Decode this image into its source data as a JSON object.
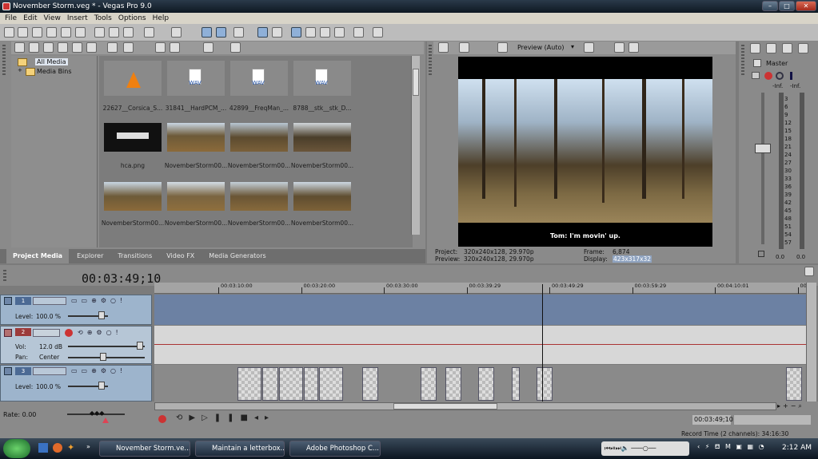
{
  "window": {
    "title": "November Storm.veg * - Vegas Pro 9.0"
  },
  "menu": [
    "File",
    "Edit",
    "View",
    "Insert",
    "Tools",
    "Options",
    "Help"
  ],
  "media_tree": {
    "items": [
      "All Media",
      "Media Bins"
    ]
  },
  "media_grid": {
    "items": [
      {
        "label": "22627__Corsica_S...",
        "kind": "vlc"
      },
      {
        "label": "31841__HardPCM_...",
        "kind": "wav"
      },
      {
        "label": "42899__FreqMan_...",
        "kind": "wav"
      },
      {
        "label": "8788__stk__stk_D...",
        "kind": "wav"
      },
      {
        "label": "hca.png",
        "kind": "logo"
      },
      {
        "label": "NovemberStorm00...",
        "kind": "forest"
      },
      {
        "label": "NovemberStorm00...",
        "kind": "forest"
      },
      {
        "label": "NovemberStorm00...",
        "kind": "forest"
      },
      {
        "label": "NovemberStorm00...",
        "kind": "forest"
      },
      {
        "label": "NovemberStorm00...",
        "kind": "forest"
      },
      {
        "label": "NovemberStorm00...",
        "kind": "forest"
      },
      {
        "label": "NovemberStorm00...",
        "kind": "forest"
      }
    ],
    "wav_badge": "WAV"
  },
  "media_tabs": [
    "Project Media",
    "Explorer",
    "Transitions",
    "Video FX",
    "Media Generators"
  ],
  "preview": {
    "mode": "Preview (Auto)",
    "subtitle": "Tom: I'm movin' up.",
    "project_label": "Project:",
    "project_value": "320x240x128, 29.970p",
    "preview_label": "Preview:",
    "preview_value": "320x240x128, 29.970p",
    "frame_label": "Frame:",
    "frame_value": "6,874",
    "display_label": "Display:",
    "display_value": "423x317x32"
  },
  "master": {
    "title": "Master",
    "inf_left": "-Inf.",
    "inf_right": "-Inf.",
    "scale": [
      "3",
      "6",
      "9",
      "12",
      "15",
      "18",
      "21",
      "24",
      "27",
      "30",
      "33",
      "36",
      "39",
      "42",
      "45",
      "48",
      "51",
      "54",
      "57"
    ],
    "val_left": "0.0",
    "val_right": "0.0"
  },
  "timeline": {
    "timecode": "00:03:49;10",
    "ruler": [
      "00:03:10:00",
      "00:03:20:00",
      "00:03:30:00",
      "00:03:39:29",
      "00:03:49:29",
      "00:03:59:29",
      "00:04:10:01",
      "00:0"
    ],
    "playhead_fraction": 0.595,
    "tracks": [
      {
        "num": "1",
        "l1": "Level:",
        "v1": "100.0 %"
      },
      {
        "num": "2",
        "l1": "Vol:",
        "v1": "12.0 dB",
        "l2": "Pan:",
        "v2": "Center"
      },
      {
        "num": "3",
        "l1": "Level:",
        "v1": "100.0 %"
      }
    ],
    "rate_label": "Rate: 0.00",
    "cursor_time": "00:03:49;10",
    "record_time": "Record Time (2 channels): 34:16:30"
  },
  "taskbar": {
    "tasks": [
      "November Storm.ve...",
      "Maintain a letterbox...",
      "Adobe Photoshop C..."
    ],
    "clock": "2:12 AM"
  },
  "colors": {
    "accent": "#6c81a3",
    "audio_lane": "#d7d7d7",
    "video_lane": "#6c81a3"
  }
}
